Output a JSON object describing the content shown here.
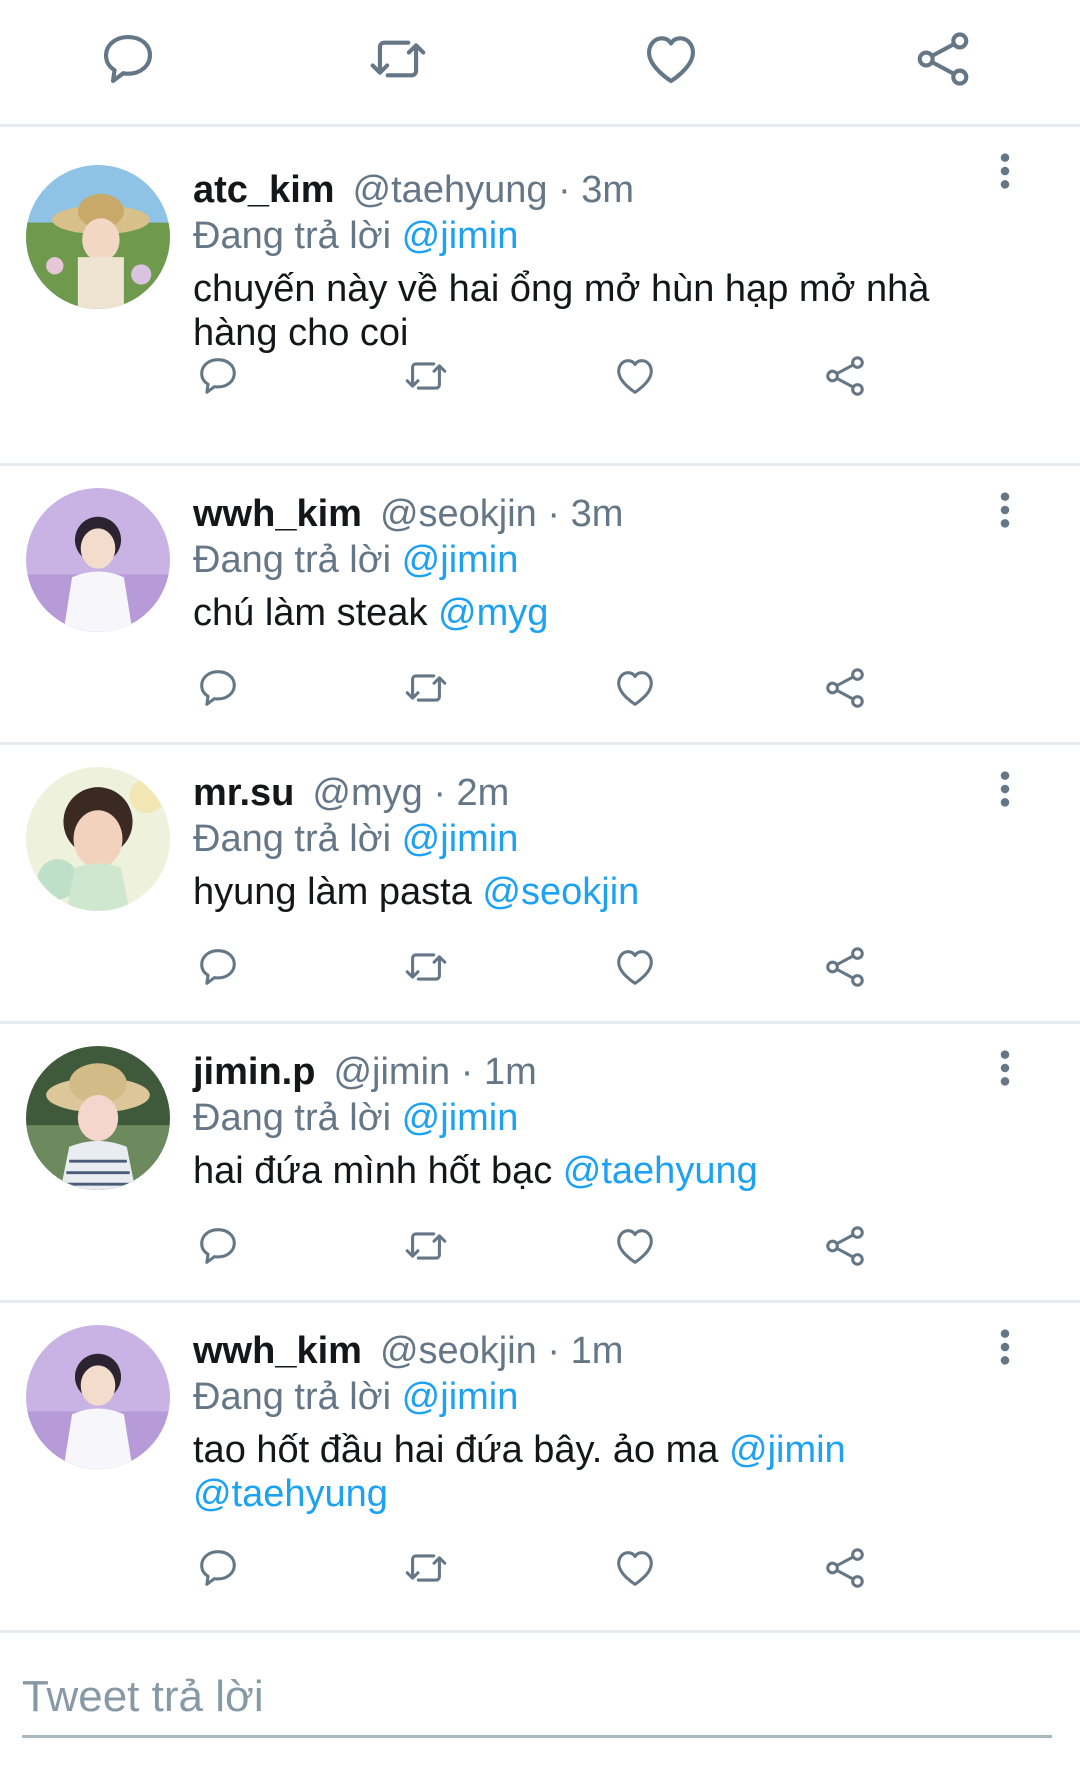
{
  "top_actions": {
    "icons": [
      "reply-icon",
      "retweet-icon",
      "like-icon",
      "share-icon"
    ],
    "icon_color": "#657786"
  },
  "tweets": [
    {
      "display_name": "atc_kim",
      "handle": "@taehyung",
      "separator": "·",
      "time": "3m",
      "replying_label": "Đang trả lời",
      "replying_to": "@jimin",
      "text": "chuyến này về hai ổng mở hùn hạp mở nhà hàng cho coi",
      "mentions": []
    },
    {
      "display_name": "wwh_kim",
      "handle": "@seokjin",
      "separator": "·",
      "time": "3m",
      "replying_label": "Đang trả lời",
      "replying_to": "@jimin",
      "text": "chú làm steak",
      "mentions": [
        "@myg"
      ]
    },
    {
      "display_name": "mr.su",
      "handle": "@myg",
      "separator": "·",
      "time": "2m",
      "replying_label": "Đang trả lời",
      "replying_to": "@jimin",
      "text": "hyung làm pasta",
      "mentions": [
        "@seokjin"
      ]
    },
    {
      "display_name": "jimin.p",
      "handle": "@jimin",
      "separator": "·",
      "time": "1m",
      "replying_label": "Đang trả lời",
      "replying_to": "@jimin",
      "text": "hai đứa mình hốt bạc",
      "mentions": [
        "@taehyung"
      ]
    },
    {
      "display_name": "wwh_kim",
      "handle": "@seokjin",
      "separator": "·",
      "time": "1m",
      "replying_label": "Đang trả lời",
      "replying_to": "@jimin",
      "text": "tao hốt đầu hai đứa bây. ảo ma",
      "mentions": [
        "@jimin",
        "@taehyung"
      ]
    }
  ],
  "reply_box": {
    "placeholder": "Tweet trả lời",
    "value": ""
  },
  "colors": {
    "link": "#1da1f2",
    "secondary_text": "#657786",
    "divider": "#e6ecf0"
  }
}
